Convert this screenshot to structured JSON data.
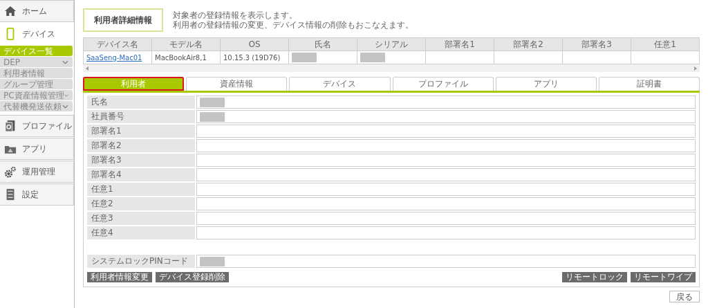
{
  "sidebar": {
    "items": [
      {
        "label": "ホーム",
        "selected": false
      },
      {
        "label": "デバイス",
        "selected": true,
        "children": [
          {
            "label": "デバイス一覧",
            "selected": true,
            "expandable": false
          },
          {
            "label": "DEP",
            "selected": false,
            "expandable": true
          },
          {
            "label": "利用者情報",
            "selected": false,
            "expandable": false
          },
          {
            "label": "グループ管理",
            "selected": false,
            "expandable": false
          },
          {
            "label": "PC資産情報管理",
            "selected": false,
            "expandable": true
          },
          {
            "label": "代替機発送依頼",
            "selected": false,
            "expandable": true
          }
        ]
      },
      {
        "label": "プロファイル",
        "selected": false
      },
      {
        "label": "アプリ",
        "selected": false
      },
      {
        "label": "運用管理",
        "selected": false
      },
      {
        "label": "設定",
        "selected": false
      }
    ]
  },
  "page": {
    "title": "利用者詳細情報",
    "description": [
      "対象者の登録情報を表示します。",
      "利用者の登録情報の変更、デバイス情報の削除もおこなえます。"
    ]
  },
  "table": {
    "columns": [
      "デバイス名",
      "モデル名",
      "OS",
      "氏名",
      "シリアル",
      "部署名1",
      "部署名2",
      "部署名3",
      "任意1"
    ],
    "rows": [
      [
        {
          "kind": "link",
          "text": "SaaSeng-Mac01"
        },
        {
          "kind": "text",
          "text": "MacBookAir8,1"
        },
        {
          "kind": "text",
          "text": "10.15.3 (19D76)"
        },
        {
          "kind": "redacted"
        },
        {
          "kind": "redacted"
        },
        {
          "kind": "empty"
        },
        {
          "kind": "empty"
        },
        {
          "kind": "empty"
        },
        {
          "kind": "empty"
        }
      ]
    ]
  },
  "tabs": [
    {
      "label": "利用者",
      "selected": true,
      "highlighted": true
    },
    {
      "label": "資産情報",
      "selected": false,
      "highlighted": false
    },
    {
      "label": "デバイス",
      "selected": false,
      "highlighted": false
    },
    {
      "label": "プロファイル",
      "selected": false,
      "highlighted": false
    },
    {
      "label": "アプリ",
      "selected": false,
      "highlighted": false
    },
    {
      "label": "証明書",
      "selected": false,
      "highlighted": false
    }
  ],
  "fields": [
    {
      "label": "氏名",
      "redacted": true
    },
    {
      "label": "社員番号",
      "redacted": true
    },
    {
      "label": "部署名1",
      "redacted": false
    },
    {
      "label": "部署名2",
      "redacted": false
    },
    {
      "label": "部署名3",
      "redacted": false
    },
    {
      "label": "部署名4",
      "redacted": false
    },
    {
      "label": "任意1",
      "redacted": false
    },
    {
      "label": "任意2",
      "redacted": false
    },
    {
      "label": "任意3",
      "redacted": false
    },
    {
      "label": "任意4",
      "redacted": false
    }
  ],
  "pin_field": {
    "label": "システムロックPINコード",
    "redacted": true
  },
  "buttons_left": [
    "利用者情報変更",
    "デバイス登録削除"
  ],
  "buttons_right": [
    "リモートロック",
    "リモートワイプ"
  ],
  "back_button": "戻る"
}
